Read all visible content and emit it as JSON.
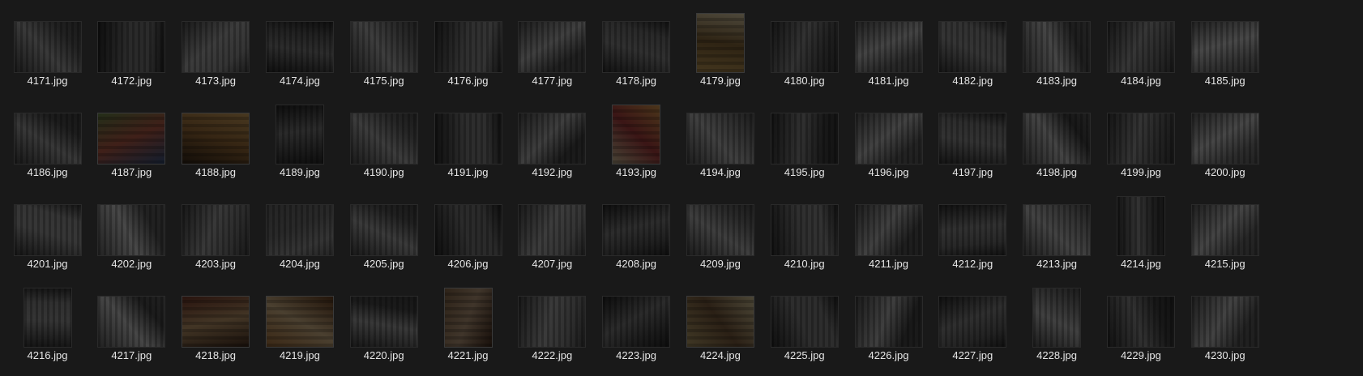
{
  "files": [
    {
      "name": "4171.jpg",
      "orientation": "landscape",
      "tone": "gray"
    },
    {
      "name": "4172.jpg",
      "orientation": "landscape",
      "tone": "gray"
    },
    {
      "name": "4173.jpg",
      "orientation": "landscape",
      "tone": "gray"
    },
    {
      "name": "4174.jpg",
      "orientation": "landscape",
      "tone": "gray"
    },
    {
      "name": "4175.jpg",
      "orientation": "landscape",
      "tone": "gray"
    },
    {
      "name": "4176.jpg",
      "orientation": "landscape",
      "tone": "gray"
    },
    {
      "name": "4177.jpg",
      "orientation": "landscape",
      "tone": "gray"
    },
    {
      "name": "4178.jpg",
      "orientation": "landscape",
      "tone": "gray"
    },
    {
      "name": "4179.jpg",
      "orientation": "portrait",
      "tone": "color",
      "colors": [
        "#c9a15a",
        "#8a6a3a",
        "#e8d8b0"
      ]
    },
    {
      "name": "4180.jpg",
      "orientation": "landscape",
      "tone": "gray"
    },
    {
      "name": "4181.jpg",
      "orientation": "landscape",
      "tone": "gray"
    },
    {
      "name": "4182.jpg",
      "orientation": "landscape",
      "tone": "gray"
    },
    {
      "name": "4183.jpg",
      "orientation": "landscape",
      "tone": "gray"
    },
    {
      "name": "4184.jpg",
      "orientation": "landscape",
      "tone": "gray"
    },
    {
      "name": "4185.jpg",
      "orientation": "landscape",
      "tone": "gray"
    },
    {
      "name": "4186.jpg",
      "orientation": "landscape",
      "tone": "gray"
    },
    {
      "name": "4187.jpg",
      "orientation": "landscape",
      "tone": "color",
      "colors": [
        "#6a8a4a",
        "#c0604a",
        "#3a5a8a"
      ]
    },
    {
      "name": "4188.jpg",
      "orientation": "landscape",
      "tone": "color",
      "colors": [
        "#3a2a1a",
        "#a0703a",
        "#d8a860"
      ]
    },
    {
      "name": "4189.jpg",
      "orientation": "portrait",
      "tone": "gray"
    },
    {
      "name": "4190.jpg",
      "orientation": "landscape",
      "tone": "gray"
    },
    {
      "name": "4191.jpg",
      "orientation": "landscape",
      "tone": "gray"
    },
    {
      "name": "4192.jpg",
      "orientation": "landscape",
      "tone": "gray"
    },
    {
      "name": "4193.jpg",
      "orientation": "portrait",
      "tone": "color",
      "colors": [
        "#d8c8a0",
        "#b04040",
        "#e0a050"
      ]
    },
    {
      "name": "4194.jpg",
      "orientation": "landscape",
      "tone": "gray"
    },
    {
      "name": "4195.jpg",
      "orientation": "landscape",
      "tone": "gray"
    },
    {
      "name": "4196.jpg",
      "orientation": "landscape",
      "tone": "gray"
    },
    {
      "name": "4197.jpg",
      "orientation": "landscape",
      "tone": "gray"
    },
    {
      "name": "4198.jpg",
      "orientation": "landscape",
      "tone": "gray"
    },
    {
      "name": "4199.jpg",
      "orientation": "landscape",
      "tone": "gray"
    },
    {
      "name": "4200.jpg",
      "orientation": "landscape",
      "tone": "gray"
    },
    {
      "name": "4201.jpg",
      "orientation": "landscape",
      "tone": "gray"
    },
    {
      "name": "4202.jpg",
      "orientation": "landscape",
      "tone": "gray"
    },
    {
      "name": "4203.jpg",
      "orientation": "landscape",
      "tone": "gray"
    },
    {
      "name": "4204.jpg",
      "orientation": "landscape",
      "tone": "gray"
    },
    {
      "name": "4205.jpg",
      "orientation": "landscape",
      "tone": "gray"
    },
    {
      "name": "4206.jpg",
      "orientation": "landscape",
      "tone": "gray"
    },
    {
      "name": "4207.jpg",
      "orientation": "landscape",
      "tone": "gray"
    },
    {
      "name": "4208.jpg",
      "orientation": "landscape",
      "tone": "gray"
    },
    {
      "name": "4209.jpg",
      "orientation": "landscape",
      "tone": "gray"
    },
    {
      "name": "4210.jpg",
      "orientation": "landscape",
      "tone": "gray"
    },
    {
      "name": "4211.jpg",
      "orientation": "landscape",
      "tone": "gray"
    },
    {
      "name": "4212.jpg",
      "orientation": "landscape",
      "tone": "gray"
    },
    {
      "name": "4213.jpg",
      "orientation": "landscape",
      "tone": "gray"
    },
    {
      "name": "4214.jpg",
      "orientation": "portrait",
      "tone": "gray"
    },
    {
      "name": "4215.jpg",
      "orientation": "landscape",
      "tone": "gray"
    },
    {
      "name": "4216.jpg",
      "orientation": "portrait",
      "tone": "gray"
    },
    {
      "name": "4217.jpg",
      "orientation": "landscape",
      "tone": "gray"
    },
    {
      "name": "4218.jpg",
      "orientation": "landscape",
      "tone": "color",
      "colors": [
        "#7a3a2a",
        "#c8a070",
        "#4a3020"
      ]
    },
    {
      "name": "4219.jpg",
      "orientation": "landscape",
      "tone": "color",
      "colors": [
        "#b07840",
        "#e0c090",
        "#6a4020"
      ]
    },
    {
      "name": "4220.jpg",
      "orientation": "landscape",
      "tone": "gray"
    },
    {
      "name": "4221.jpg",
      "orientation": "portrait",
      "tone": "color",
      "colors": [
        "#8a6a4a",
        "#c0a080",
        "#4a3020"
      ]
    },
    {
      "name": "4222.jpg",
      "orientation": "landscape",
      "tone": "gray"
    },
    {
      "name": "4223.jpg",
      "orientation": "landscape",
      "tone": "gray"
    },
    {
      "name": "4224.jpg",
      "orientation": "landscape",
      "tone": "color",
      "colors": [
        "#c0a870",
        "#806040",
        "#e0d0a0"
      ]
    },
    {
      "name": "4225.jpg",
      "orientation": "landscape",
      "tone": "gray"
    },
    {
      "name": "4226.jpg",
      "orientation": "landscape",
      "tone": "gray"
    },
    {
      "name": "4227.jpg",
      "orientation": "landscape",
      "tone": "gray"
    },
    {
      "name": "4228.jpg",
      "orientation": "portrait",
      "tone": "gray"
    },
    {
      "name": "4229.jpg",
      "orientation": "landscape",
      "tone": "gray"
    },
    {
      "name": "4230.jpg",
      "orientation": "landscape",
      "tone": "gray"
    }
  ]
}
